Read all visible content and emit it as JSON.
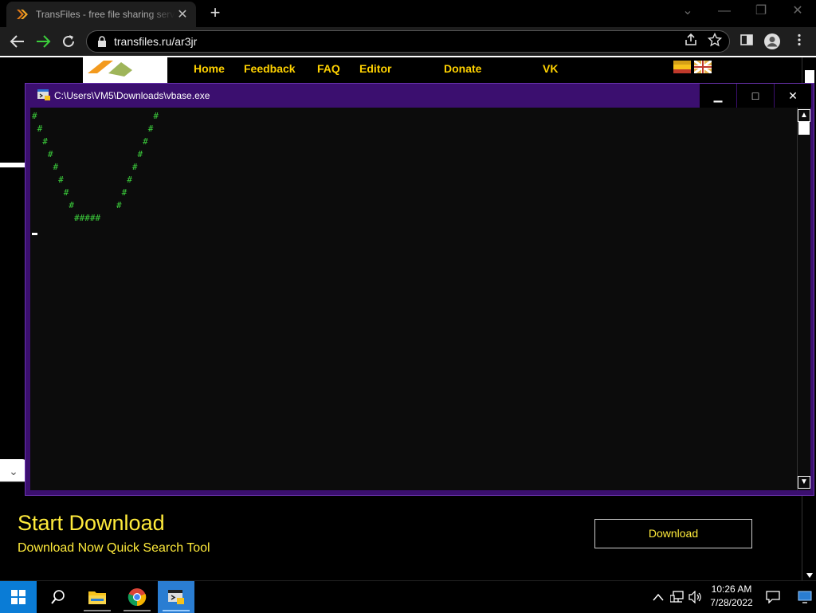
{
  "browser": {
    "tab_title": "TransFiles - free file sharing service",
    "tab_close": "✕",
    "new_tab": "+",
    "url": "transfiles.ru/ar3jr",
    "win_min": "⌄",
    "win_minimize": "—",
    "win_restore": "❐",
    "win_close": "✕"
  },
  "site": {
    "nav": [
      "Home",
      "Feedback",
      "FAQ",
      "Editor",
      "Donate",
      "VK"
    ],
    "ad": {
      "toggle": "⌄",
      "title": "Start Download",
      "subtitle": "Download Now Quick Search Tool",
      "button": "Download"
    }
  },
  "console": {
    "title": "C:\\Users\\VM5\\Downloads\\vbase.exe",
    "output": "#                      #\n #                    #\n  #                  #\n   #                #\n    #              #\n     #            #\n      #          #\n       #        #\n        #####",
    "btn_min": "▁",
    "btn_max": "□",
    "btn_close": "✕",
    "scroll_up": "▲",
    "scroll_down": "▼"
  },
  "taskbar": {
    "time": "10:26 AM",
    "date": "7/28/2022",
    "up_arrow": "⌃",
    "speaker": "🔊"
  },
  "colors": {
    "console_frame": "#3b0f6f",
    "console_text": "#3ccf3c",
    "site_nav": "#ffd200",
    "ad_text": "#ffeb3b",
    "taskbar_active": "#2a7dd2"
  }
}
